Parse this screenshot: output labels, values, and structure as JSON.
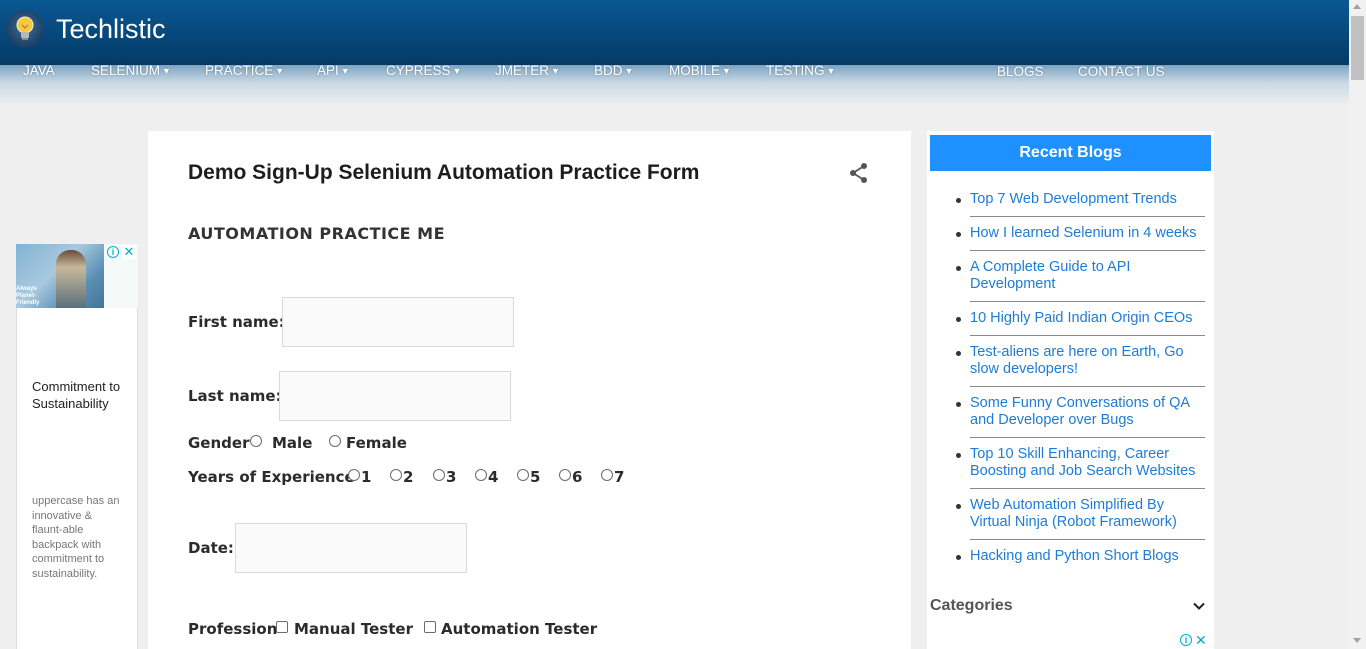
{
  "header": {
    "site_title": "Techlistic",
    "logo_icon": "lightbulb-icon",
    "bg_color": "#064678"
  },
  "nav": {
    "items": [
      {
        "label": "JAVA",
        "has_caret": false
      },
      {
        "label": "SELENIUM",
        "has_caret": true
      },
      {
        "label": "PRACTICE",
        "has_caret": true
      },
      {
        "label": "API",
        "has_caret": true
      },
      {
        "label": "CYPRESS",
        "has_caret": true
      },
      {
        "label": "JMETER",
        "has_caret": true
      },
      {
        "label": "BDD",
        "has_caret": true
      },
      {
        "label": "MOBILE",
        "has_caret": true
      },
      {
        "label": "TESTING",
        "has_caret": true
      },
      {
        "label": "BLOGS",
        "has_caret": false
      },
      {
        "label": "CONTACT US",
        "has_caret": false
      }
    ]
  },
  "post": {
    "title": "Demo Sign-Up Selenium Automation Practice Form",
    "share_icon": "share-icon",
    "section_heading": "AUTOMATION PRACTICE ME"
  },
  "form": {
    "first_name_label": "First name:",
    "first_name_value": "",
    "last_name_label": "Last name:",
    "last_name_value": "",
    "gender_label": "Gender",
    "gender_options": [
      "Male",
      "Female"
    ],
    "experience_label": "Years of Experience",
    "experience_options": [
      "1",
      "2",
      "3",
      "4",
      "5",
      "6",
      "7"
    ],
    "date_label": "Date:",
    "date_value": "",
    "profession_label": "Profession",
    "profession_options": [
      "Manual Tester",
      "Automation Tester"
    ]
  },
  "ad": {
    "image_caption": "Always Planet-Friendly",
    "headline": "Commitment to Sustainability",
    "description": "uppercase has an innovative & flaunt-able backpack with commitment to sustainability.",
    "info_icon": "info-icon",
    "close_icon": "close-icon"
  },
  "sidebar": {
    "recent_title": "Recent Blogs",
    "accent_color": "#1e90ff",
    "blogs": [
      "Top 7 Web Development Trends",
      "How I learned Selenium in 4 weeks",
      "A Complete Guide to API Development",
      "10 Highly Paid Indian Origin CEOs",
      "Test-aliens are here on Earth, Go slow developers!",
      "Some Funny Conversations of QA and Developer over Bugs",
      "Top 10 Skill Enhancing, Career Boosting and Job Search Websites",
      "Web Automation Simplified By Virtual Ninja (Robot Framework)",
      "Hacking and Python Short Blogs"
    ],
    "categories_label": "Categories",
    "categories_icon": "chevron-down-icon"
  }
}
